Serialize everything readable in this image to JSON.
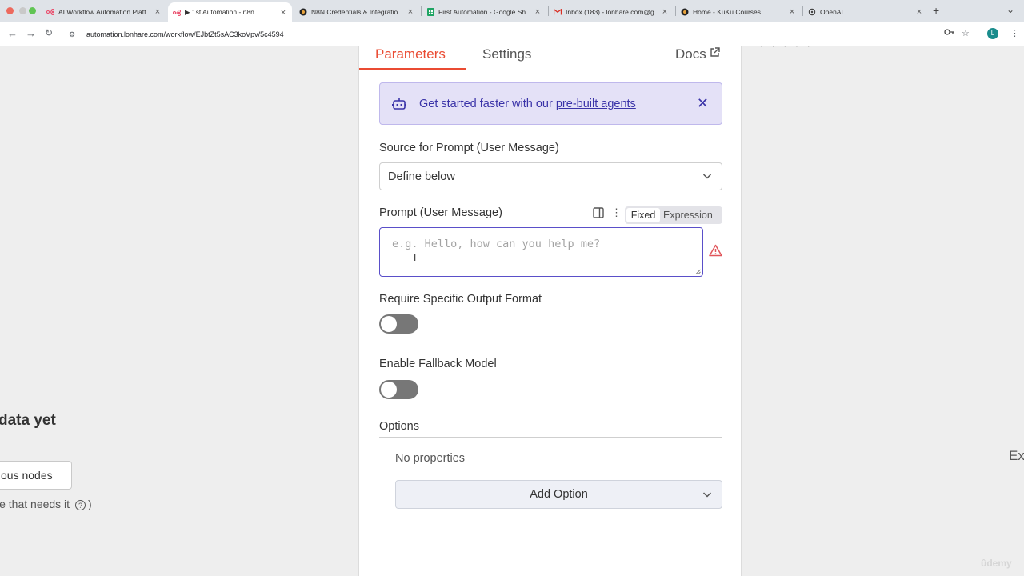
{
  "browser": {
    "tabs": [
      {
        "title": "AI Workflow Automation Platf",
        "favicon": "n8n-icon"
      },
      {
        "title": "▶ 1st Automation - n8n",
        "favicon": "n8n-icon"
      },
      {
        "title": "N8N Credentials & Integratio",
        "favicon": "kuku-icon"
      },
      {
        "title": "First Automation - Google Sh",
        "favicon": "sheets-icon"
      },
      {
        "title": "Inbox (183) - lonhare.com@g",
        "favicon": "gmail-icon"
      },
      {
        "title": "Home - KuKu Courses",
        "favicon": "kuku-icon"
      },
      {
        "title": "OpenAI",
        "favicon": "openai-icon"
      }
    ],
    "url": "automation.lonhare.com/workflow/EJbtZt5sAC3koVpv/5c4594",
    "profile_initial": "L"
  },
  "canvas": {
    "no_data_text": "data yet",
    "prev_nodes_button": "ous nodes",
    "hint_text": "le that needs it",
    "hint_close": ")",
    "right_edge_text": "Ex",
    "brand_watermark": "ûdemy"
  },
  "panel": {
    "tabs": {
      "parameters": "Parameters",
      "settings": "Settings",
      "docs": "Docs"
    },
    "banner": {
      "text": "Get started faster with our ",
      "link": "pre-built agents"
    },
    "source_label": "Source for Prompt (User Message)",
    "source_value": "Define below",
    "prompt_label": "Prompt (User Message)",
    "mode_fixed": "Fixed",
    "mode_expression": "Expression",
    "prompt_placeholder": "e.g. Hello, how can you help me?",
    "output_format_label": "Require Specific Output Format",
    "output_format_enabled": false,
    "fallback_label": "Enable Fallback Model",
    "fallback_enabled": false,
    "options_title": "Options",
    "no_properties": "No properties",
    "add_option": "Add Option"
  },
  "colors": {
    "accent": "#ea4b32",
    "banner_bg": "#e4e1f7",
    "banner_text": "#3a33a8",
    "focus": "#5a4fc9"
  }
}
